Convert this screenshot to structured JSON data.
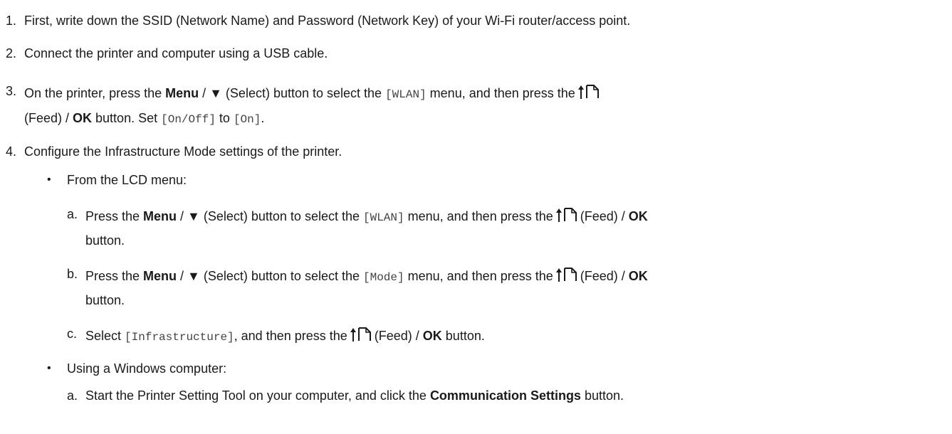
{
  "steps": {
    "s1": {
      "num": "1.",
      "text": "First, write down the SSID (Network Name) and Password (Network Key) of your Wi-Fi router/access point."
    },
    "s2": {
      "num": "2.",
      "text": "Connect the printer and computer using a USB cable."
    },
    "s3": {
      "num": "3.",
      "a": "On the printer, press the ",
      "menu": "Menu",
      "sel": " / ▼ (Select) button to select the ",
      "code": "[WLAN]",
      "b": " menu, and then press the",
      "feed": "(Feed) / ",
      "ok": "OK",
      "c": " button. Set ",
      "code2": "[On/Off]",
      "to": " to ",
      "code3": "[On]",
      "end": "."
    },
    "s4": {
      "num": "4.",
      "text": "Configure the Infrastructure Mode settings of the printer."
    }
  },
  "bullets": {
    "lcd": {
      "mark": "•",
      "text": "From the LCD menu:"
    },
    "win": {
      "mark": "•",
      "text": "Using a Windows computer:"
    }
  },
  "lcd": {
    "a": {
      "letter": "a.",
      "pre": "Press the ",
      "menu": "Menu",
      "sel": " / ▼ (Select) button to select the ",
      "code": "[WLAN]",
      "post": " menu, and then press the",
      "feed": "(Feed) / ",
      "ok": "OK",
      "tail": "button."
    },
    "b": {
      "letter": "b.",
      "pre": "Press the ",
      "menu": "Menu",
      "sel": " / ▼ (Select) button to select the ",
      "code": "[Mode]",
      "post": " menu, and then press the",
      "feed": "(Feed) / ",
      "ok": "OK",
      "tail": "button."
    },
    "c": {
      "letter": "c.",
      "pre": "Select ",
      "code": "[Infrastructure]",
      "post": ", and then press the",
      "feed": "(Feed) / ",
      "ok": "OK",
      "end": " button."
    }
  },
  "win": {
    "a": {
      "letter": "a.",
      "pre": "Start the Printer Setting Tool on your computer, and click the ",
      "bold": "Communication Settings",
      "end": " button."
    }
  },
  "icons": {
    "feed": "feed-icon"
  }
}
